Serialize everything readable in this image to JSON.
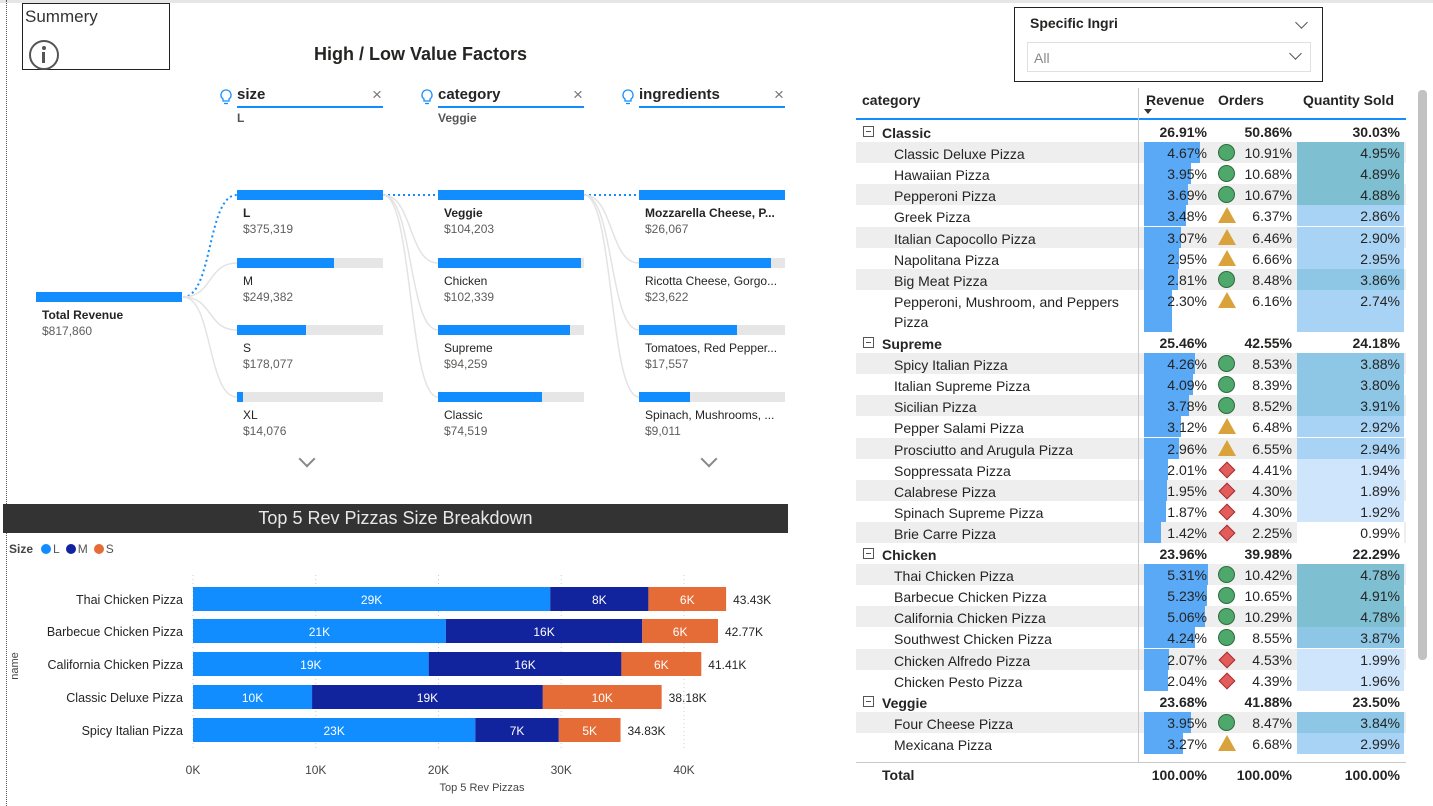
{
  "summary": {
    "title": "Summery",
    "icon": "info-icon"
  },
  "decomp": {
    "title": "High / Low Value Factors",
    "root": {
      "label": "Total Revenue",
      "value": "$817,860"
    },
    "levels": [
      {
        "field": "size",
        "selected": "L",
        "nodes": [
          {
            "label": "L",
            "value": "$375,319",
            "ratio": 1.0
          },
          {
            "label": "M",
            "value": "$249,382",
            "ratio": 0.664
          },
          {
            "label": "S",
            "value": "$178,077",
            "ratio": 0.474
          },
          {
            "label": "XL",
            "value": "$14,076",
            "ratio": 0.04
          }
        ]
      },
      {
        "field": "category",
        "selected": "Veggie",
        "nodes": [
          {
            "label": "Veggie",
            "value": "$104,203",
            "ratio": 1.0
          },
          {
            "label": "Chicken",
            "value": "$102,339",
            "ratio": 0.982
          },
          {
            "label": "Supreme",
            "value": "$94,259",
            "ratio": 0.905
          },
          {
            "label": "Classic",
            "value": "$74,519",
            "ratio": 0.715
          }
        ]
      },
      {
        "field": "ingredients",
        "selected": "",
        "nodes": [
          {
            "label": "Mozzarella Cheese, P...",
            "value": "$26,067",
            "ratio": 1.0
          },
          {
            "label": "Ricotta Cheese, Gorgo...",
            "value": "$23,622",
            "ratio": 0.906
          },
          {
            "label": "Tomatoes, Red Pepper...",
            "value": "$17,557",
            "ratio": 0.674
          },
          {
            "label": "Spinach, Mushrooms, ...",
            "value": "$9,011",
            "ratio": 0.346
          }
        ]
      }
    ]
  },
  "bar_chart_header": "Top 5 Rev Pizzas Size Breakdown",
  "legend": {
    "title": "Size",
    "items": [
      {
        "label": "L",
        "color": "#118dff"
      },
      {
        "label": "M",
        "color": "#12239e"
      },
      {
        "label": "S",
        "color": "#e66c37"
      }
    ]
  },
  "chart_data": {
    "type": "bar",
    "orientation": "horizontal",
    "stacked": true,
    "categories": [
      "Thai Chicken Pizza",
      "Barbecue Chicken Pizza",
      "California Chicken Pizza",
      "Classic Deluxe Pizza",
      "Spicy Italian Pizza"
    ],
    "series": [
      {
        "name": "L",
        "color": "#118dff",
        "values": [
          29.1,
          20.6,
          19.2,
          9.7,
          23.0
        ],
        "labels": [
          "29K",
          "21K",
          "19K",
          "10K",
          "23K"
        ]
      },
      {
        "name": "M",
        "color": "#12239e",
        "values": [
          8.0,
          16.0,
          15.7,
          18.8,
          6.8
        ],
        "labels": [
          "8K",
          "16K",
          "16K",
          "19K",
          "7K"
        ]
      },
      {
        "name": "S",
        "color": "#e66c37",
        "values": [
          6.33,
          6.17,
          6.51,
          9.68,
          5.03
        ],
        "labels": [
          "6K",
          "6K",
          "6K",
          "10K",
          "5K"
        ]
      }
    ],
    "totals": [
      "43.43K",
      "42.77K",
      "41.41K",
      "38.18K",
      "34.83K"
    ],
    "xlabel": "Top 5 Rev Pizzas",
    "ylabel": "name",
    "xlim": [
      0,
      45
    ],
    "xticks": [
      0,
      10,
      20,
      30,
      40
    ],
    "xtick_labels": [
      "0K",
      "10K",
      "20K",
      "30K",
      "40K"
    ],
    "grid": true,
    "legend_position": "top-left"
  },
  "slicer": {
    "title": "Specific Ingri",
    "value": "All"
  },
  "matrix": {
    "columns": [
      "category",
      "Revenue",
      "Orders",
      "Quantity Sold"
    ],
    "groups": [
      {
        "name": "Classic",
        "revenue": "26.91%",
        "orders": "50.86%",
        "qty": "30.03%",
        "rows": [
          {
            "name": "Classic Deluxe Pizza",
            "revenue": "4.67%",
            "rev": 4.67,
            "orders": "10.91%",
            "icon": "circle",
            "qty": "4.95%",
            "q": 4.95
          },
          {
            "name": "Hawaiian Pizza",
            "revenue": "3.95%",
            "rev": 3.95,
            "orders": "10.68%",
            "icon": "circle",
            "qty": "4.89%",
            "q": 4.89
          },
          {
            "name": "Pepperoni Pizza",
            "revenue": "3.69%",
            "rev": 3.69,
            "orders": "10.67%",
            "icon": "circle",
            "qty": "4.88%",
            "q": 4.88
          },
          {
            "name": "Greek Pizza",
            "revenue": "3.48%",
            "rev": 3.48,
            "orders": "6.37%",
            "icon": "triangle",
            "qty": "2.86%",
            "q": 2.86
          },
          {
            "name": "Italian Capocollo Pizza",
            "revenue": "3.07%",
            "rev": 3.07,
            "orders": "6.46%",
            "icon": "triangle",
            "qty": "2.90%",
            "q": 2.9
          },
          {
            "name": "Napolitana Pizza",
            "revenue": "2.95%",
            "rev": 2.95,
            "orders": "6.66%",
            "icon": "triangle",
            "qty": "2.95%",
            "q": 2.95
          },
          {
            "name": "Big Meat Pizza",
            "revenue": "2.81%",
            "rev": 2.81,
            "orders": "8.48%",
            "icon": "circle",
            "qty": "3.86%",
            "q": 3.86
          },
          {
            "name": "Pepperoni, Mushroom, and Peppers Pizza",
            "revenue": "2.30%",
            "rev": 2.3,
            "orders": "6.16%",
            "icon": "triangle",
            "qty": "2.74%",
            "q": 2.74,
            "tall": true
          }
        ]
      },
      {
        "name": "Supreme",
        "revenue": "25.46%",
        "orders": "42.55%",
        "qty": "24.18%",
        "rows": [
          {
            "name": "Spicy Italian Pizza",
            "revenue": "4.26%",
            "rev": 4.26,
            "orders": "8.53%",
            "icon": "circle",
            "qty": "3.88%",
            "q": 3.88
          },
          {
            "name": "Italian Supreme Pizza",
            "revenue": "4.09%",
            "rev": 4.09,
            "orders": "8.39%",
            "icon": "circle",
            "qty": "3.80%",
            "q": 3.8
          },
          {
            "name": "Sicilian Pizza",
            "revenue": "3.78%",
            "rev": 3.78,
            "orders": "8.52%",
            "icon": "circle",
            "qty": "3.91%",
            "q": 3.91
          },
          {
            "name": "Pepper Salami Pizza",
            "revenue": "3.12%",
            "rev": 3.12,
            "orders": "6.48%",
            "icon": "triangle",
            "qty": "2.92%",
            "q": 2.92
          },
          {
            "name": "Prosciutto and Arugula Pizza",
            "revenue": "2.96%",
            "rev": 2.96,
            "orders": "6.55%",
            "icon": "triangle",
            "qty": "2.94%",
            "q": 2.94
          },
          {
            "name": "Soppressata Pizza",
            "revenue": "2.01%",
            "rev": 2.01,
            "orders": "4.41%",
            "icon": "diamond",
            "qty": "1.94%",
            "q": 1.94
          },
          {
            "name": "Calabrese Pizza",
            "revenue": "1.95%",
            "rev": 1.95,
            "orders": "4.30%",
            "icon": "diamond",
            "qty": "1.89%",
            "q": 1.89
          },
          {
            "name": "Spinach Supreme Pizza",
            "revenue": "1.87%",
            "rev": 1.87,
            "orders": "4.30%",
            "icon": "diamond",
            "qty": "1.92%",
            "q": 1.92
          },
          {
            "name": "Brie Carre Pizza",
            "revenue": "1.42%",
            "rev": 1.42,
            "orders": "2.25%",
            "icon": "diamond",
            "qty": "0.99%",
            "q": 0.99
          }
        ]
      },
      {
        "name": "Chicken",
        "revenue": "23.96%",
        "orders": "39.98%",
        "qty": "22.29%",
        "rows": [
          {
            "name": "Thai Chicken Pizza",
            "revenue": "5.31%",
            "rev": 5.31,
            "orders": "10.42%",
            "icon": "circle",
            "qty": "4.78%",
            "q": 4.78
          },
          {
            "name": "Barbecue Chicken Pizza",
            "revenue": "5.23%",
            "rev": 5.23,
            "orders": "10.65%",
            "icon": "circle",
            "qty": "4.91%",
            "q": 4.91
          },
          {
            "name": "California Chicken Pizza",
            "revenue": "5.06%",
            "rev": 5.06,
            "orders": "10.29%",
            "icon": "circle",
            "qty": "4.78%",
            "q": 4.78
          },
          {
            "name": "Southwest Chicken Pizza",
            "revenue": "4.24%",
            "rev": 4.24,
            "orders": "8.55%",
            "icon": "circle",
            "qty": "3.87%",
            "q": 3.87
          },
          {
            "name": "Chicken Alfredo Pizza",
            "revenue": "2.07%",
            "rev": 2.07,
            "orders": "4.53%",
            "icon": "diamond",
            "qty": "1.99%",
            "q": 1.99
          },
          {
            "name": "Chicken Pesto Pizza",
            "revenue": "2.04%",
            "rev": 2.04,
            "orders": "4.39%",
            "icon": "diamond",
            "qty": "1.96%",
            "q": 1.96
          }
        ]
      },
      {
        "name": "Veggie",
        "revenue": "23.68%",
        "orders": "41.88%",
        "qty": "23.50%",
        "rows": [
          {
            "name": "Four Cheese Pizza",
            "revenue": "3.95%",
            "rev": 3.95,
            "orders": "8.47%",
            "icon": "circle",
            "qty": "3.84%",
            "q": 3.84
          },
          {
            "name": "Mexicana Pizza",
            "revenue": "3.27%",
            "rev": 3.27,
            "orders": "6.68%",
            "icon": "triangle",
            "qty": "2.99%",
            "q": 2.99
          }
        ]
      }
    ],
    "total": {
      "name": "Total",
      "revenue": "100.00%",
      "orders": "100.00%",
      "qty": "100.00%"
    }
  }
}
